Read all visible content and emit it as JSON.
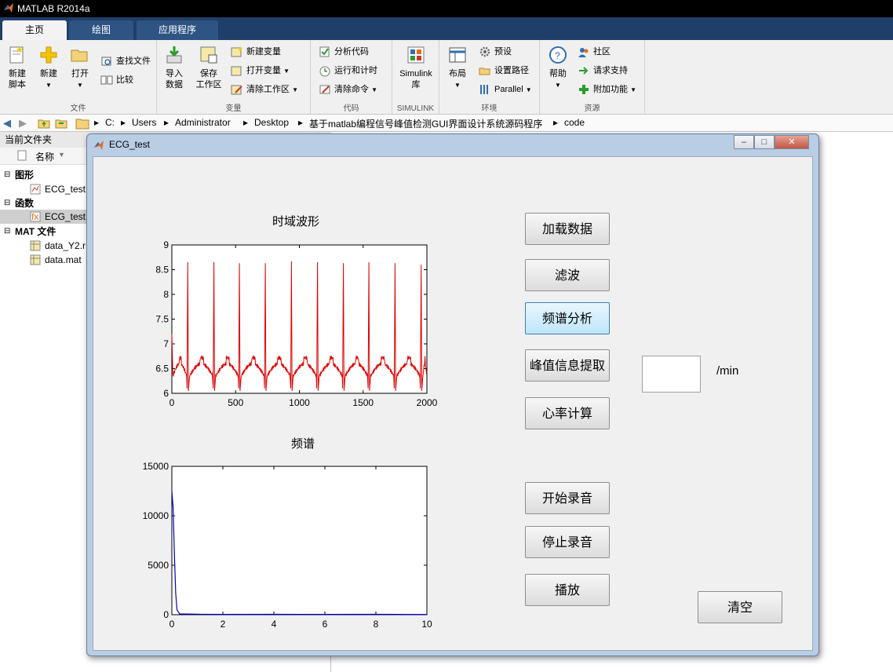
{
  "app": {
    "title": "MATLAB R2014a"
  },
  "tabs": [
    {
      "label": "主页"
    },
    {
      "label": "绘图"
    },
    {
      "label": "应用程序"
    }
  ],
  "ribbon": {
    "file": {
      "label": "文件",
      "new_script": "新建\n脚本",
      "new": "新建",
      "open": "打开",
      "find_files": "查找文件",
      "compare": "比较"
    },
    "variable": {
      "label": "变量",
      "import": "导入\n数据",
      "save_ws": "保存\n工作区",
      "new_var": "新建变量",
      "open_var": "打开变量",
      "clear_ws": "清除工作区"
    },
    "code": {
      "label": "代码",
      "analyze": "分析代码",
      "run_time": "运行和计时",
      "clear_cmd": "清除命令"
    },
    "simulink": {
      "label": "SIMULINK",
      "lib": "Simulink\n库"
    },
    "env": {
      "label": "环境",
      "layout": "布局",
      "prefs": "预设",
      "set_path": "设置路径",
      "parallel": "Parallel"
    },
    "resources": {
      "label": "资源",
      "help": "帮助",
      "community": "社区",
      "support": "请求支持",
      "addons": "附加功能"
    }
  },
  "address": {
    "crumbs": [
      "C:",
      "Users",
      "Administrator",
      "Desktop",
      "基于matlab编程信号峰值检测GUI界面设计系统源码程序",
      "code"
    ]
  },
  "current_folder": {
    "header": "当前文件夹",
    "col_name": "名称",
    "groups": [
      {
        "label": "图形",
        "items": [
          "ECG_test."
        ]
      },
      {
        "label": "函数",
        "items": [
          "ECG_test."
        ]
      },
      {
        "label": "MAT 文件",
        "items": [
          "data_Y2.r",
          "data.mat"
        ]
      }
    ]
  },
  "figure": {
    "title": "ECG_test",
    "buttons": {
      "load": "加载数据",
      "filter": "滤波",
      "spectrum": "频谱分析",
      "peak": "峰值信息提取",
      "heart_rate": "心率计算",
      "start_rec": "开始录音",
      "stop_rec": "停止录音",
      "play": "播放",
      "clear": "清空"
    },
    "heart_rate_value": "",
    "heart_rate_unit": "/min"
  },
  "chart_data": [
    {
      "type": "line",
      "title": "时域波形",
      "xlim": [
        0,
        2000
      ],
      "ylim": [
        6,
        9
      ],
      "xticks": [
        "0",
        "500",
        "1000",
        "1500",
        "2000"
      ],
      "yticks": [
        "6",
        "6.5",
        "7",
        "7.5",
        "8",
        "8.5",
        "9"
      ],
      "color": "#e00000",
      "baseline": 6.35,
      "r_peaks": [
        {
          "x": 125,
          "y": 8.65
        },
        {
          "x": 330,
          "y": 8.65
        },
        {
          "x": 530,
          "y": 8.63
        },
        {
          "x": 733,
          "y": 8.63
        },
        {
          "x": 938,
          "y": 8.67
        },
        {
          "x": 1142,
          "y": 8.65
        },
        {
          "x": 1345,
          "y": 8.63
        },
        {
          "x": 1545,
          "y": 8.65
        },
        {
          "x": 1750,
          "y": 8.63
        },
        {
          "x": 1955,
          "y": 8.6
        }
      ],
      "start_value": 7.2,
      "end_value": 6.45
    },
    {
      "type": "line",
      "title": "频谱",
      "xlim": [
        0,
        10
      ],
      "ylim": [
        0,
        15000
      ],
      "xticks": [
        "0",
        "2",
        "4",
        "6",
        "8",
        "10"
      ],
      "yticks": [
        "0",
        "5000",
        "10000",
        "15000"
      ],
      "color": "#0000c0",
      "points": [
        [
          0,
          12500
        ],
        [
          0.05,
          10800
        ],
        [
          0.1,
          6000
        ],
        [
          0.15,
          2200
        ],
        [
          0.2,
          500
        ],
        [
          0.3,
          80
        ],
        [
          1,
          50
        ],
        [
          2,
          30
        ],
        [
          4,
          40
        ],
        [
          6,
          30
        ],
        [
          8,
          40
        ],
        [
          10,
          20
        ]
      ]
    }
  ]
}
